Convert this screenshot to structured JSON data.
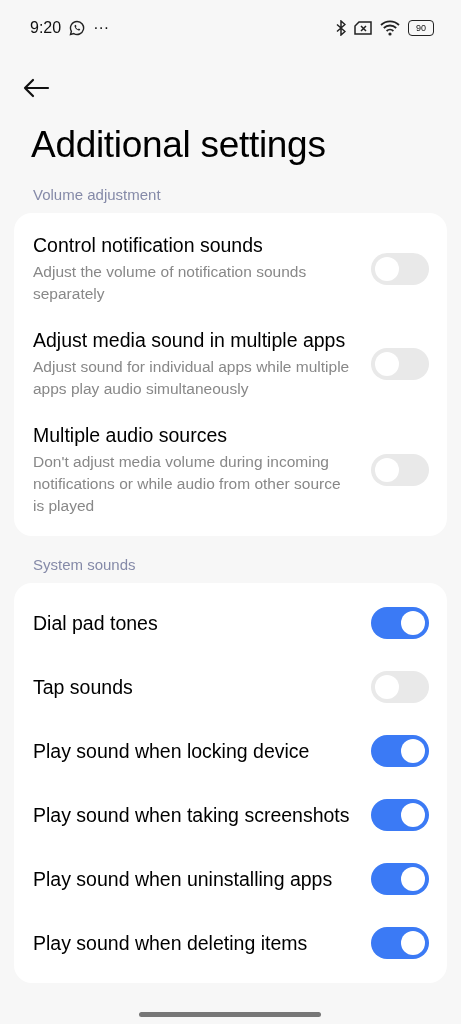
{
  "status_bar": {
    "time": "9:20",
    "more": "···",
    "battery": "90"
  },
  "title": "Additional settings",
  "sections": [
    {
      "header": "Volume adjustment",
      "items": [
        {
          "title": "Control notification sounds",
          "subtitle": "Adjust the volume of notification sounds separately",
          "on": false
        },
        {
          "title": "Adjust media sound in multiple apps",
          "subtitle": "Adjust sound for individual apps while multiple apps play audio simultaneously",
          "on": false
        },
        {
          "title": "Multiple audio sources",
          "subtitle": "Don't adjust media volume during incoming notifications or while audio from other source is played",
          "on": false
        }
      ]
    },
    {
      "header": "System sounds",
      "items": [
        {
          "title": "Dial pad tones",
          "on": true
        },
        {
          "title": "Tap sounds",
          "on": false
        },
        {
          "title": "Play sound when locking device",
          "on": true
        },
        {
          "title": "Play sound when taking screenshots",
          "on": true
        },
        {
          "title": "Play sound when uninstalling apps",
          "on": true
        },
        {
          "title": "Play sound when deleting items",
          "on": true
        }
      ]
    }
  ]
}
